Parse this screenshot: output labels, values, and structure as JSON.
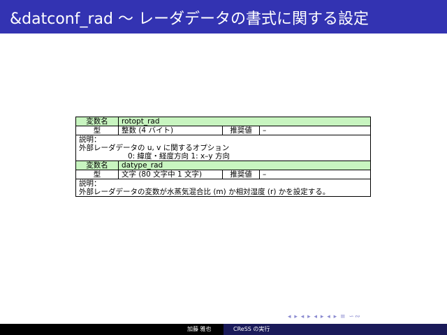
{
  "slide": {
    "title": "&datconf_rad 〜 レーダデータの書式に関する設定"
  },
  "entries": [
    {
      "var_label": "変数名",
      "var_name": "rotopt_rad",
      "type_label": "型",
      "type_value": "整数 (4 バイト)",
      "rec_label": "推奨値",
      "rec_value": "–",
      "desc_label": "説明：",
      "desc_text": "外部レーダデータの u, v に関するオプション",
      "desc_options": "0: 緯度・経度方向 1: x–y 方向"
    },
    {
      "var_label": "変数名",
      "var_name": "datype_rad",
      "type_label": "型",
      "type_value": "文字 (80 文字中 1 文字)",
      "rec_label": "推奨値",
      "rec_value": "–",
      "desc_label": "説明：",
      "desc_text": "外部レーダデータの変数が水蒸気混合比 (m) か相対湿度 (r) かを設定する。"
    }
  ],
  "footer": {
    "author": "加藤 雅也",
    "talk": "CReSS の実行"
  },
  "navigation": {
    "symbols": "◂ ▸ ◂ ▸ ◂ ▸ ◂ ▸ ≡ ∽∾"
  },
  "colors": {
    "title_bar": "#3333b2",
    "highlight_cell": "#c8f5c0",
    "footer_right": "#1a1a59"
  }
}
